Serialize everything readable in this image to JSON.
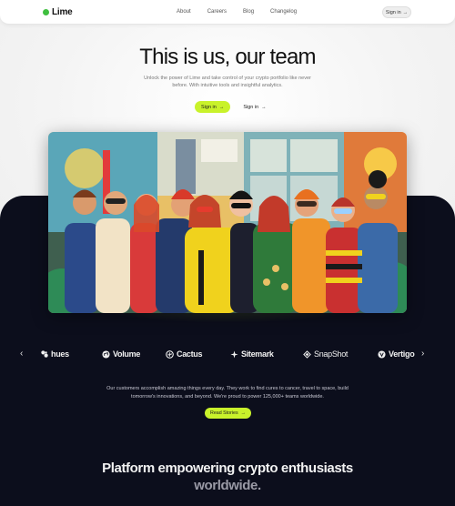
{
  "brand": {
    "name": "Lime",
    "dot_color": "#3fbf3f"
  },
  "nav": {
    "links": [
      "About",
      "Careers",
      "Blog",
      "Changelog"
    ],
    "signin_label": "Sign in",
    "signin_arrow": "→"
  },
  "hero": {
    "title": "This is us, our team",
    "subtitle_line1": "Unlock the power of Lime and take control of your crypto portfolio like never",
    "subtitle_line2": "before. With intuitive tools and insightful analytics.",
    "primary_label": "Sign in",
    "secondary_label": "Sign in",
    "arrow": "→",
    "accent": "#c9f22b"
  },
  "partners": {
    "prev_arrow": "‹",
    "next_arrow": "›",
    "items": [
      {
        "name": "hues",
        "icon": "hues-icon"
      },
      {
        "name": "Volume",
        "icon": "volume-icon"
      },
      {
        "name": "Cactus",
        "icon": "cactus-icon"
      },
      {
        "name": "Sitemark",
        "icon": "sitemark-icon"
      },
      {
        "name": "SnapShot",
        "icon": "snapshot-icon"
      },
      {
        "name": "Vertigo",
        "icon": "vertigo-icon"
      }
    ]
  },
  "customers": {
    "line1": "Our customers accomplish amazing things every day. They work to find cures to cancer, travel to space, build",
    "line2": "tomorrow's innovations, and beyond. We're proud to power 125,000+ teams worldwide.",
    "cta_label": "Read Stories",
    "cta_arrow": "→"
  },
  "platform": {
    "line1": "Platform empowering crypto enthusiasts",
    "line2": "worldwide."
  },
  "colors": {
    "dark_bg": "#0c0e1c",
    "light_bg": "#f3f3f3"
  }
}
